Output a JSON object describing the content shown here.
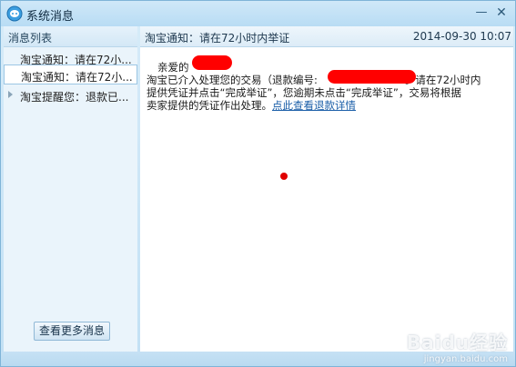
{
  "window": {
    "title": "系统消息"
  },
  "left_panel": {
    "header": "消息列表",
    "items": [
      {
        "label": "淘宝通知：请在72小..."
      },
      {
        "label": "淘宝通知：请在72小..."
      },
      {
        "label": "淘宝提醒您：退款已..."
      }
    ],
    "more_button": "查看更多消息"
  },
  "message": {
    "subject": "淘宝通知：请在72小时内举证",
    "date": "2014-09-30 10:07",
    "greeting": "亲爱的",
    "line2_a": "淘宝已介入处理您的交易（退款编号:",
    "line2_b": "。请在72小时内",
    "line3": "提供凭证并点击“完成举证”，您逾期未点击“完成举证”，交易将根据",
    "line4_a": "卖家提供的凭证作出处理。",
    "link_text": "点此查看退款详情"
  },
  "watermark": {
    "text": "Baidu经验",
    "sub": "jingyan.baidu.com"
  },
  "colors": {
    "accent": "#1a5ea8",
    "redaction": "#ff0000",
    "titlebar": "#b8dcf4"
  },
  "icons": {
    "app": "chat-bubble-icon",
    "minimize": "minimize-icon",
    "close": "close-icon"
  }
}
